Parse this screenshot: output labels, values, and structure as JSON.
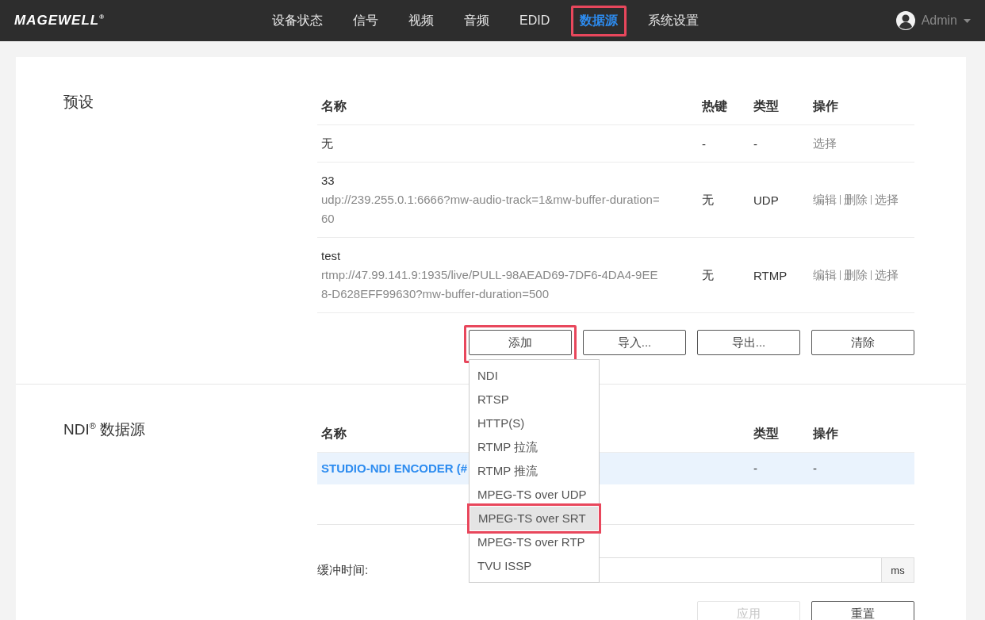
{
  "header": {
    "logo": "MAGEWELL",
    "logo_mark": "®",
    "nav": [
      {
        "label": "设备状态",
        "selected": false
      },
      {
        "label": "信号",
        "selected": false
      },
      {
        "label": "视频",
        "selected": false
      },
      {
        "label": "音频",
        "selected": false
      },
      {
        "label": "EDID",
        "selected": false
      },
      {
        "label": "数据源",
        "selected": true
      },
      {
        "label": "系统设置",
        "selected": false
      }
    ],
    "user": "Admin"
  },
  "presets": {
    "title": "预设",
    "columns": [
      "名称",
      "热键",
      "类型",
      "操作"
    ],
    "rows": [
      {
        "name": "无",
        "url": "",
        "hotkey": "-",
        "type": "-",
        "actions": [
          "选择"
        ]
      },
      {
        "name": "33",
        "url": "udp://239.255.0.1:6666?mw-audio-track=1&mw-buffer-duration=60",
        "hotkey": "无",
        "type": "UDP",
        "actions": [
          "编辑",
          "删除",
          "选择"
        ]
      },
      {
        "name": "test",
        "url": "rtmp://47.99.141.9:1935/live/PULL-98AEAD69-7DF6-4DA4-9EE8-D628EFF99630?mw-buffer-duration=500",
        "hotkey": "无",
        "type": "RTMP",
        "actions": [
          "编辑",
          "删除",
          "选择"
        ]
      }
    ],
    "buttons": [
      {
        "label": "添加",
        "highlighted": true
      },
      {
        "label": "导入...",
        "highlighted": false
      },
      {
        "label": "导出...",
        "highlighted": false
      },
      {
        "label": "清除",
        "highlighted": false
      }
    ],
    "add_menu": [
      {
        "label": "NDI",
        "selected": false
      },
      {
        "label": "RTSP",
        "selected": false
      },
      {
        "label": "HTTP(S)",
        "selected": false
      },
      {
        "label": "RTMP 拉流",
        "selected": false
      },
      {
        "label": "RTMP 推流",
        "selected": false
      },
      {
        "label": "MPEG-TS over UDP",
        "selected": false
      },
      {
        "label": "MPEG-TS over SRT",
        "selected": true
      },
      {
        "label": "MPEG-TS over RTP",
        "selected": false
      },
      {
        "label": "TVU ISSP",
        "selected": false
      }
    ]
  },
  "ndi": {
    "title": "NDI$^{®}$ 数据源",
    "columns": [
      "名称",
      "类型",
      "操作"
    ],
    "rows": [
      {
        "name": "STUDIO-NDI ENCODER (#",
        "type": "-",
        "action": "-",
        "selected": true
      }
    ],
    "buffer_label": "缓冲时间:",
    "buffer_unit": "ms",
    "buttons": [
      {
        "label": "应用",
        "disabled": true
      },
      {
        "label": "重置",
        "disabled": false
      }
    ]
  }
}
